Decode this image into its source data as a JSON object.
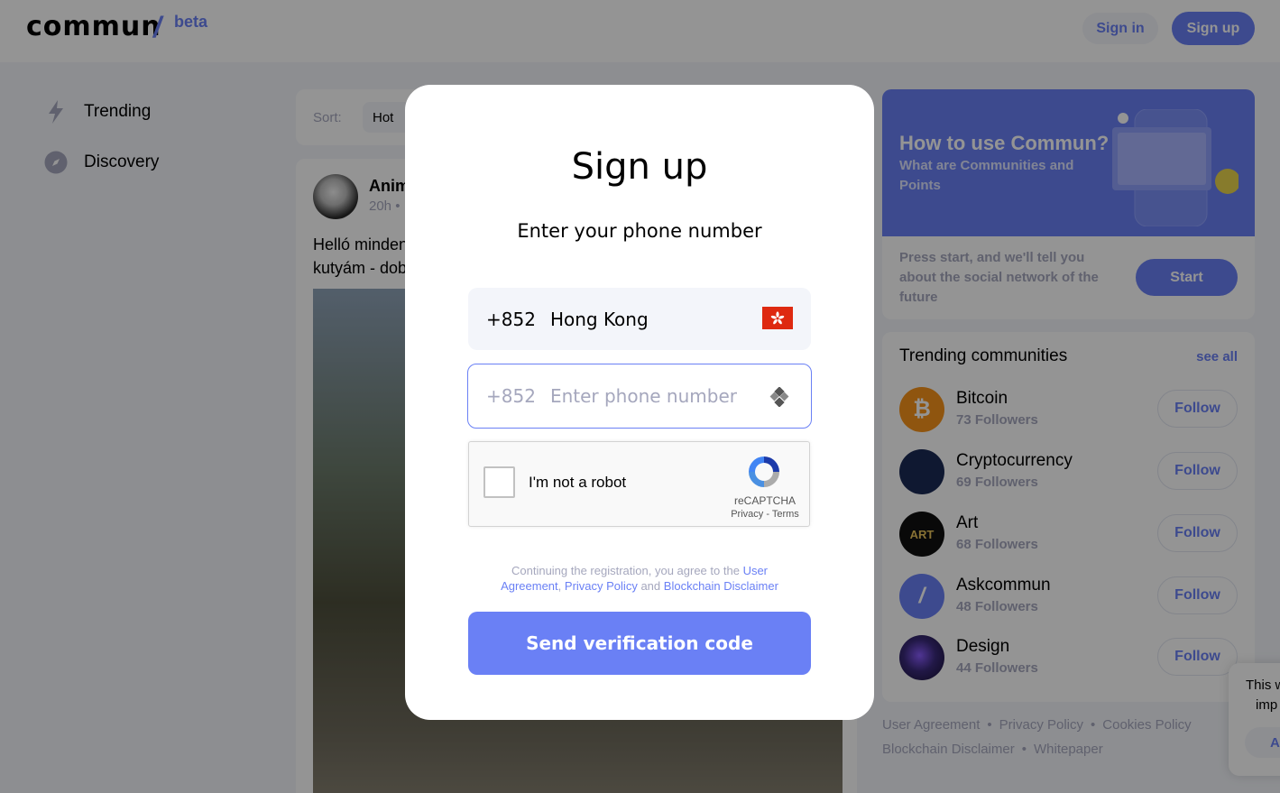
{
  "header": {
    "logo": "commun",
    "logo_slash": "/",
    "logo_badge": "beta",
    "sign_in_label": "Sign in",
    "sign_up_label": "Sign up"
  },
  "nav": {
    "items": [
      {
        "label": "Trending",
        "icon": "lightning-icon"
      },
      {
        "label": "Discovery",
        "icon": "compass-icon"
      }
    ]
  },
  "feed": {
    "sort_label": "Sort:",
    "sort_value": "Hot",
    "post": {
      "author": "Anim",
      "time": "20h",
      "time_separator": "•",
      "text_line1": "Helló minden",
      "text_line2": "kutyám - dob"
    }
  },
  "promo": {
    "title": "How to use Commun?",
    "subtitle": "What are Communities and Points",
    "description": "Press start, and we'll tell you about the social network of the future",
    "start_label": "Start"
  },
  "trending": {
    "title": "Trending communities",
    "see_all": "see all",
    "follow_label": "Follow",
    "communities": [
      {
        "name": "Bitcoin",
        "followers": "73 Followers",
        "color": "#f7931a",
        "glyph": "₿"
      },
      {
        "name": "Cryptocurrency",
        "followers": "69 Followers",
        "color": "#1b2a55",
        "glyph": ""
      },
      {
        "name": "Art",
        "followers": "68 Followers",
        "color": "#111111",
        "glyph": "ART"
      },
      {
        "name": "Askcommun",
        "followers": "48 Followers",
        "color": "#6a80f5",
        "glyph": "/"
      },
      {
        "name": "Design",
        "followers": "44 Followers",
        "color": "#2a1f4f",
        "glyph": ""
      }
    ]
  },
  "footer": {
    "links": [
      "User Agreement",
      "Privacy Policy",
      "Cookies Policy",
      "Blockchain Disclaimer",
      "Whitepaper"
    ],
    "separator": "•"
  },
  "cookie": {
    "text_line1": "This w",
    "text_line2": "imp",
    "button": "Ac"
  },
  "modal": {
    "title": "Sign up",
    "subtitle": "Enter your phone number",
    "country_code": "+852",
    "country_name": "Hong Kong",
    "phone_code": "+852",
    "phone_placeholder": "Enter phone number",
    "captcha_label": "I'm not a robot",
    "captcha_brand": "reCAPTCHA",
    "captcha_links": "Privacy - Terms",
    "terms_prefix": "Continuing the registration, you agree to the",
    "terms_user_agreement": "User Agreement",
    "terms_comma": ",",
    "terms_privacy": "Privacy Policy",
    "terms_and": "and",
    "terms_blockchain": "Blockchain Disclaimer",
    "send_label": "Send verification code"
  },
  "colors": {
    "accent": "#6a80f5",
    "muted": "#a5a7bd",
    "background": "#f3f5fa"
  }
}
